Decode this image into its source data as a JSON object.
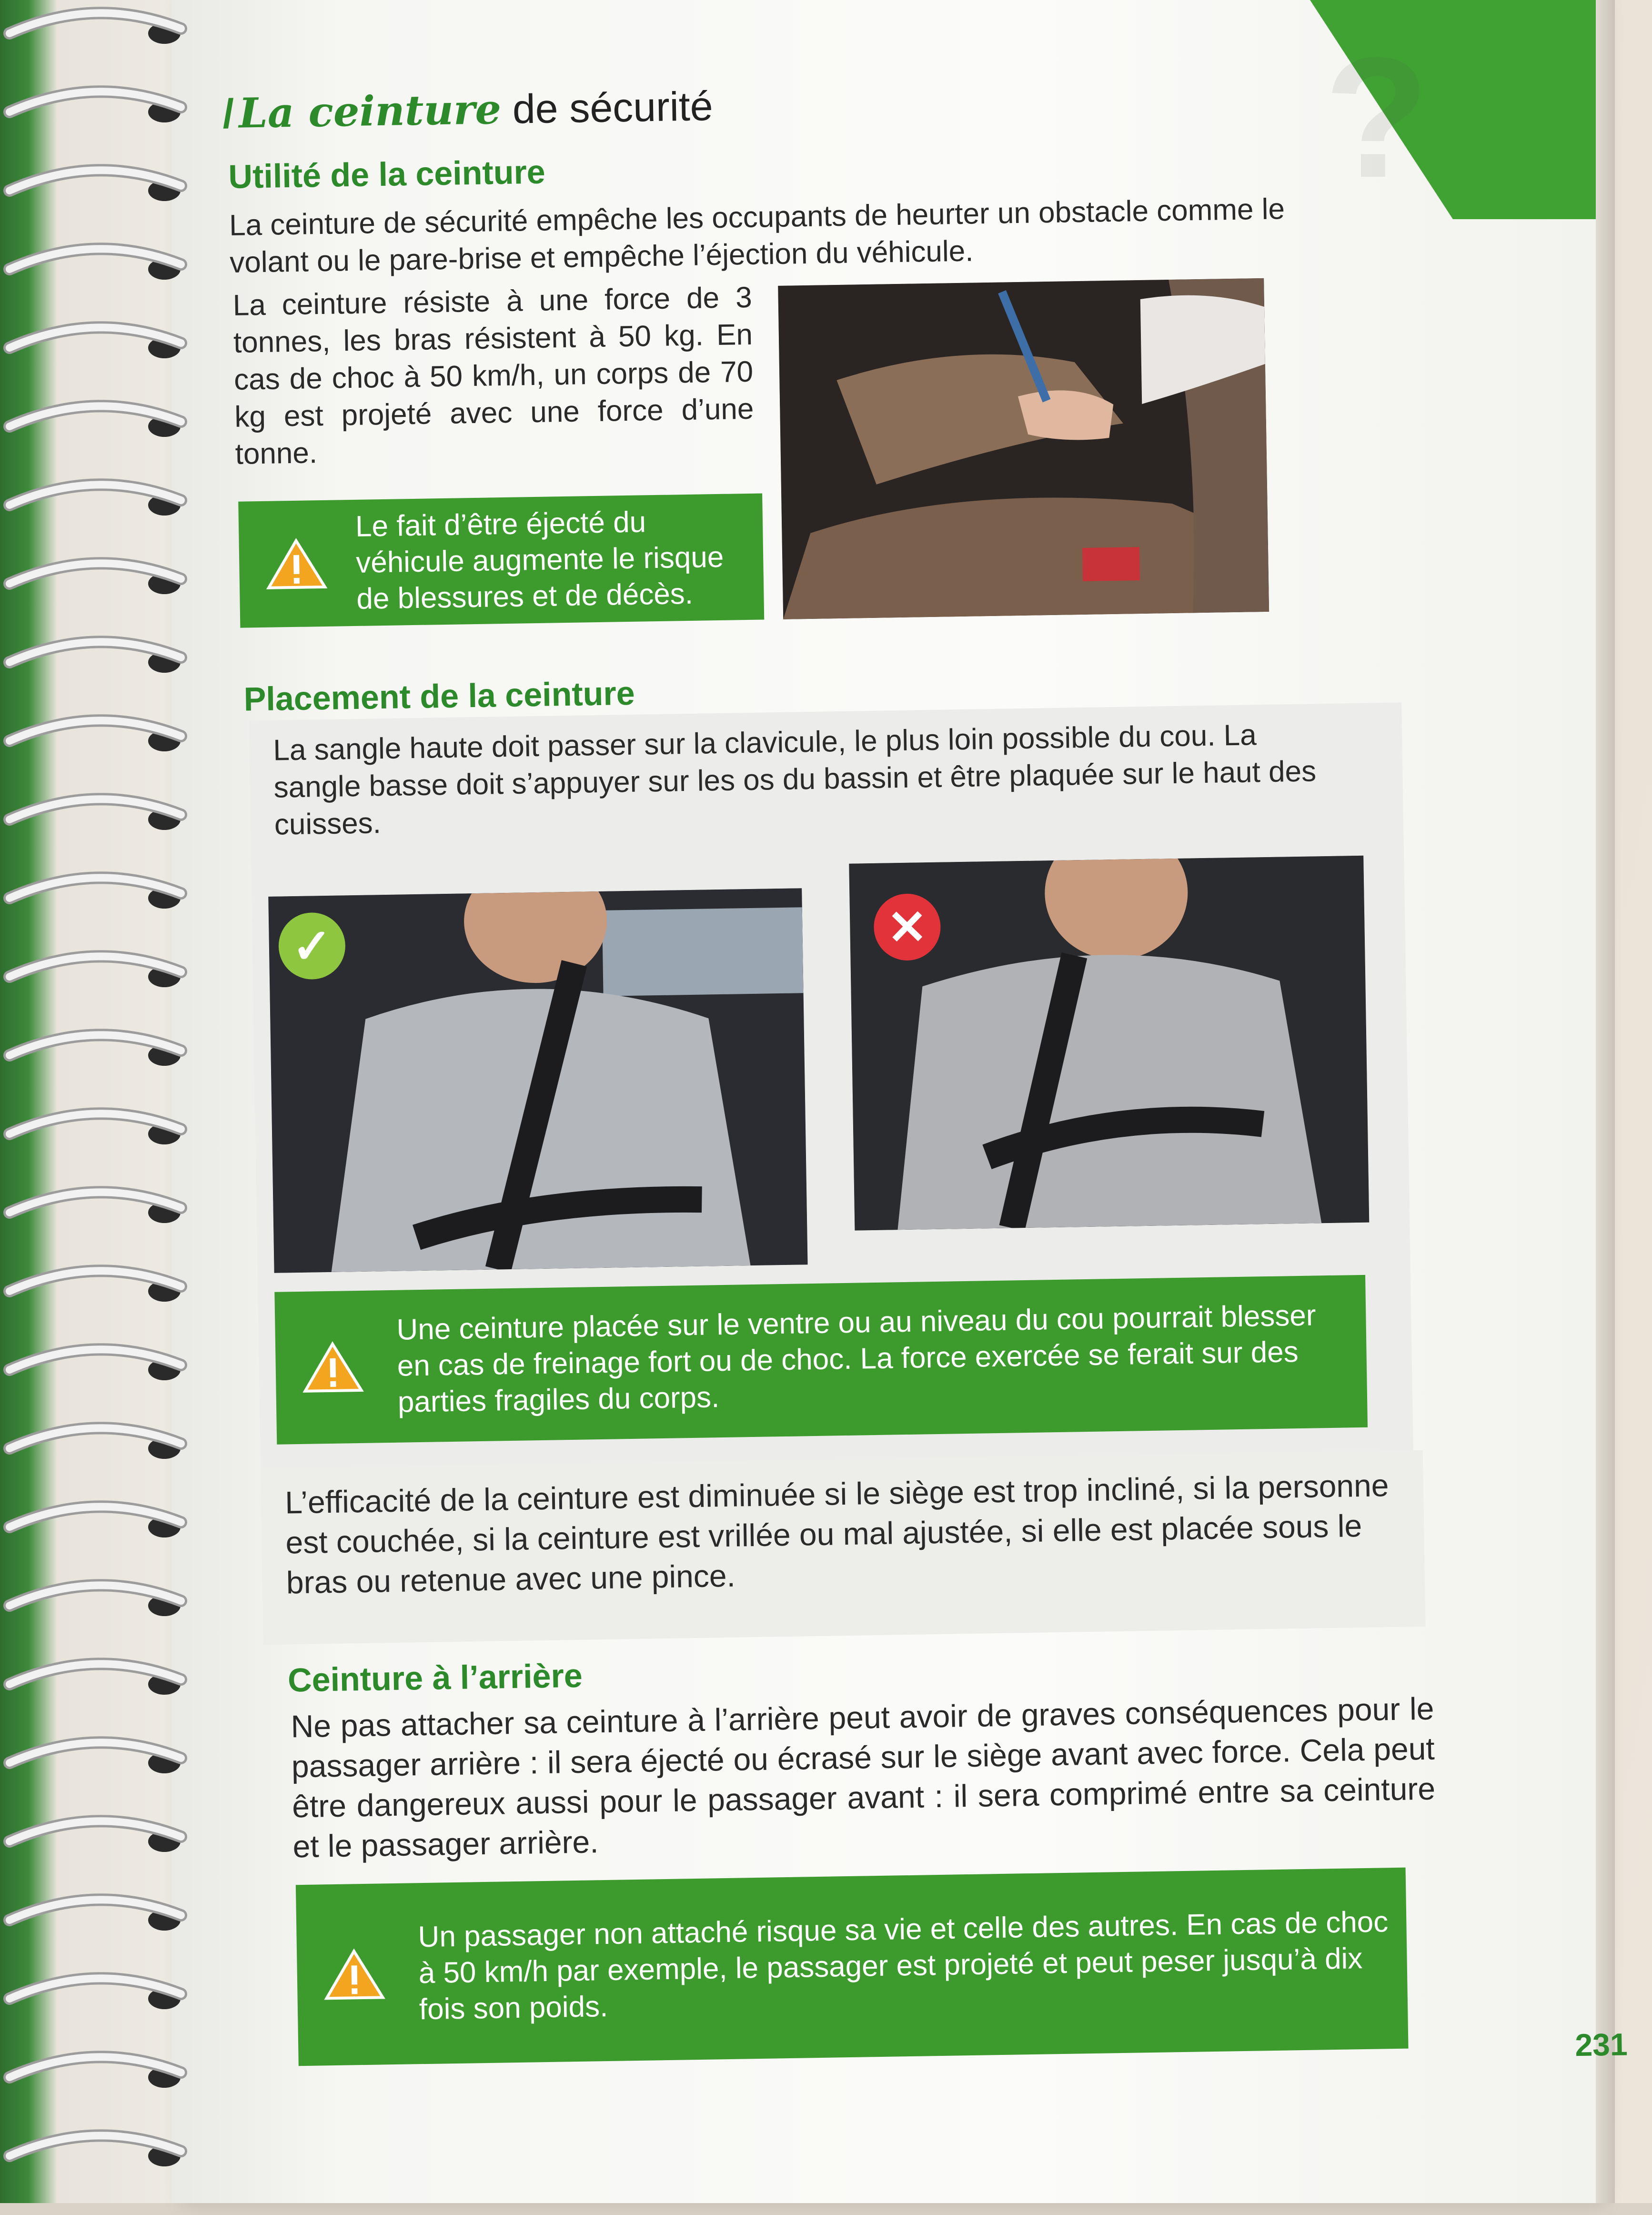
{
  "page": {
    "section_title_script": "La ceinture",
    "section_title_rest": "de sécurité",
    "page_number": "231"
  },
  "utilite": {
    "heading": "Utilité de la ceinture",
    "intro": "La ceinture de sécurité empêche les occupants de heurter un obstacle comme le volant ou le pare-brise et empêche l’éjection du véhicule.",
    "force_text": "La ceinture résiste à une force de 3 tonnes, les bras résistent à 50 kg. En cas de choc à 50 km/h, un corps de 70 kg est projeté avec une force d’une tonne.",
    "warning": "Le fait d’être éjecté du véhicule augmente le risque de blessures et de décès."
  },
  "placement": {
    "heading": "Placement de la ceinture",
    "text": "La sangle haute doit passer sur la clavicule, le plus loin possible du cou. La sangle basse doit s’appuyer sur les os du bassin et être plaquée sur le haut des cuisses.",
    "photo_correct_badge": "✓",
    "photo_wrong_badge": "✕",
    "warning": "Une ceinture placée sur le ventre ou au niveau du cou pourrait blesser en cas de freinage fort ou de choc. La force exercée se ferait sur des parties fragiles du corps.",
    "efficacite": "L’efficacité de la ceinture est diminuée si le siège est trop incliné, si la personne est couchée, si la ceinture est vrillée ou mal ajustée, si elle est placée sous le bras ou retenue avec une pince."
  },
  "arriere": {
    "heading": "Ceinture à l’arrière",
    "text": "Ne pas attacher sa ceinture à l’arrière peut avoir de graves conséquences pour le passager arrière : il sera éjecté ou écrasé sur le siège avant avec force. Cela peut être dangereux aussi pour le passager avant : il sera comprimé entre sa ceinture et le passager arrière.",
    "warning": "Un passager non attaché risque sa vie et celle des autres. En cas de choc à 50 km/h par exemple, le passager est projeté et peut peser jusqu’à dix fois son poids."
  },
  "colors": {
    "brand_green": "#3c9b2c",
    "heading_green": "#2c8a2a",
    "warning_orange": "#f3a51f",
    "ok_green": "#8ec63f",
    "error_red": "#e2333a"
  },
  "icons": [
    "warning-triangle-icon",
    "check-icon",
    "cross-icon"
  ]
}
